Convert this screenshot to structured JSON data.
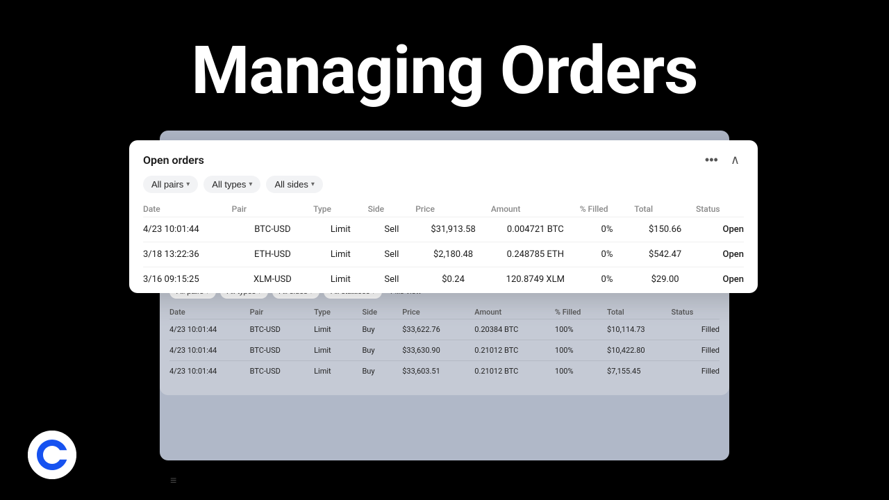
{
  "page": {
    "title": "Managing Orders",
    "coinbase_logo_alt": "Coinbase logo"
  },
  "open_orders_panel": {
    "title": "Open orders",
    "more_icon": "•••",
    "collapse_icon": "∧",
    "filters": [
      {
        "label": "All pairs",
        "id": "all-pairs"
      },
      {
        "label": "All types",
        "id": "all-types"
      },
      {
        "label": "All sides",
        "id": "all-sides"
      }
    ],
    "table": {
      "headers": [
        "Date",
        "Pair",
        "Type",
        "Side",
        "Price",
        "Amount",
        "% Filled",
        "Total",
        "Status"
      ],
      "rows": [
        {
          "date": "4/23 10:01:44",
          "pair": "BTC-USD",
          "type": "Limit",
          "side": "Sell",
          "price": "$31,913.58",
          "amount": "0.004721 BTC",
          "filled": "0%",
          "total": "$150.66",
          "status": "Open"
        },
        {
          "date": "3/18 13:22:36",
          "pair": "ETH-USD",
          "type": "Limit",
          "side": "Sell",
          "price": "$2,180.48",
          "amount": "0.248785 ETH",
          "filled": "0%",
          "total": "$542.47",
          "status": "Open"
        },
        {
          "date": "3/16 09:15:25",
          "pair": "XLM-USD",
          "type": "Limit",
          "side": "Sell",
          "price": "$0.24",
          "amount": "120.8749 XLM",
          "filled": "0%",
          "total": "$29.00",
          "status": "Open"
        }
      ]
    }
  },
  "bg_panel": {
    "filters": [
      {
        "label": "All pairs"
      },
      {
        "label": "All types"
      },
      {
        "label": "All sides"
      },
      {
        "label": "All statuses"
      },
      {
        "label": "Fills view",
        "plain": true
      }
    ],
    "table": {
      "headers": [
        "Date",
        "Pair",
        "Type",
        "Side",
        "Price",
        "Amount",
        "% Filled",
        "Total",
        "Status"
      ],
      "rows": [
        {
          "date": "4/23 10:01:44",
          "pair": "BTC-USD",
          "type": "Limit",
          "side": "Buy",
          "price": "$33,622.76",
          "amount": "0.20384 BTC",
          "filled": "100%",
          "total": "$10,114.73",
          "status": "Filled"
        },
        {
          "date": "4/23 10:01:44",
          "pair": "BTC-USD",
          "type": "Limit",
          "side": "Buy",
          "price": "$33,630.90",
          "amount": "0.21012 BTC",
          "filled": "100%",
          "total": "$10,422.80",
          "status": "Filled"
        },
        {
          "date": "4/23 10:01:44",
          "pair": "BTC-USD",
          "type": "Limit",
          "side": "Buy",
          "price": "$33,603.51",
          "amount": "0.21012 BTC",
          "filled": "100%",
          "total": "$7,155.45",
          "status": "Filled"
        }
      ]
    }
  }
}
